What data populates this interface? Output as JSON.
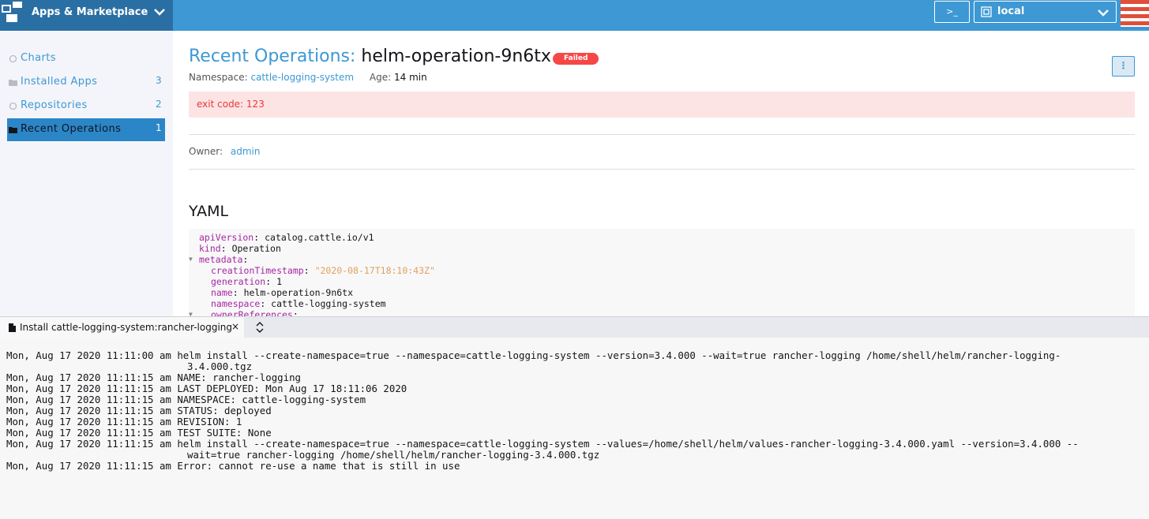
{
  "header": {
    "brand_title": "Apps & Marketplace",
    "shell_label": ">_",
    "cluster": "local"
  },
  "sidebar": {
    "items": [
      {
        "label": "Charts",
        "count": ""
      },
      {
        "label": "Installed Apps",
        "count": "3"
      },
      {
        "label": "Repositories",
        "count": "2"
      },
      {
        "label": "Recent Operations",
        "count": "1"
      }
    ]
  },
  "main": {
    "breadcrumb": "Recent Operations",
    "separator": ":",
    "name": "helm-operation-9n6tx",
    "status": "Failed",
    "actions_label": "⋮",
    "namespace_label": "Namespace:",
    "namespace": "cattle-logging-system",
    "age_label": "Age:",
    "age": "14 min",
    "error": "exit code: 123",
    "owner_label": "Owner:",
    "owner": "admin",
    "yaml_heading": "YAML",
    "yaml": [
      {
        "fold": "",
        "key": "apiVersion",
        "value": "catalog.cattle.io/v1",
        "type": "plain"
      },
      {
        "fold": "",
        "key": "kind",
        "value": "Operation",
        "type": "plain"
      },
      {
        "fold": "▼",
        "key": "metadata",
        "value": "",
        "type": "plain"
      },
      {
        "fold": "",
        "key": "creationTimestamp",
        "value": "\"2020-08-17T18:10:43Z\"",
        "type": "str"
      },
      {
        "fold": "",
        "key": "generation",
        "value": "1",
        "type": "plain"
      },
      {
        "fold": "",
        "key": "name",
        "value": "helm-operation-9n6tx",
        "type": "plain"
      },
      {
        "fold": "",
        "key": "namespace",
        "value": "cattle-logging-system",
        "type": "plain"
      },
      {
        "fold": "▼",
        "key": "ownerReferences",
        "value": "",
        "type": "plain"
      }
    ]
  },
  "terminal": {
    "tab_label": "Install cattle-logging-system:rancher-logging",
    "close_label": "×",
    "lines": [
      "Mon, Aug 17 2020 11:11:00 am helm install --create-namespace=true --namespace=cattle-logging-system --version=3.4.000 --wait=true rancher-logging /home/shell/helm/rancher-logging-3.4.000.tgz",
      "Mon, Aug 17 2020 11:11:15 am NAME: rancher-logging",
      "Mon, Aug 17 2020 11:11:15 am LAST DEPLOYED: Mon Aug 17 18:11:06 2020",
      "Mon, Aug 17 2020 11:11:15 am NAMESPACE: cattle-logging-system",
      "Mon, Aug 17 2020 11:11:15 am STATUS: deployed",
      "Mon, Aug 17 2020 11:11:15 am REVISION: 1",
      "Mon, Aug 17 2020 11:11:15 am TEST SUITE: None",
      "Mon, Aug 17 2020 11:11:15 am helm install --create-namespace=true --namespace=cattle-logging-system --values=/home/shell/helm/values-rancher-logging-3.4.000.yaml --version=3.4.000 --wait=true rancher-logging /home/shell/helm/rancher-logging-3.4.000.tgz",
      "Mon, Aug 17 2020 11:11:15 am Error: cannot re-use a name that is still in use"
    ]
  }
}
